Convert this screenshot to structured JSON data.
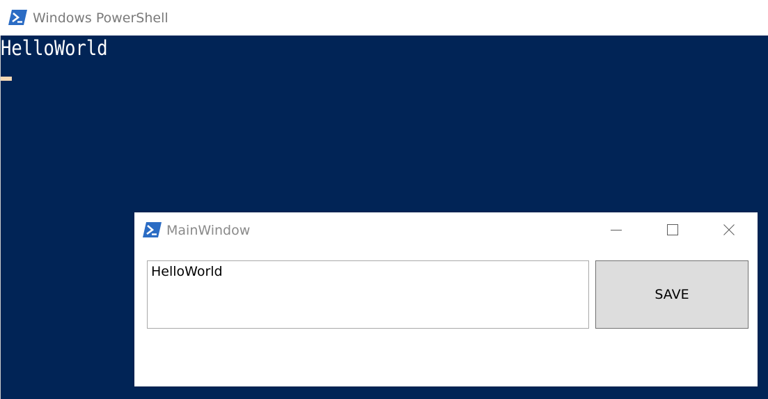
{
  "powershell": {
    "title": "Windows PowerShell",
    "icon": "powershell-icon",
    "background_color": "#012456",
    "output_lines": [
      "HelloWorld"
    ]
  },
  "main_window": {
    "title": "MainWindow",
    "icon": "powershell-icon",
    "textbox_value": "HelloWorld",
    "save_label": "SAVE",
    "caption_buttons": [
      "minimize-icon",
      "maximize-icon",
      "close-icon"
    ]
  }
}
